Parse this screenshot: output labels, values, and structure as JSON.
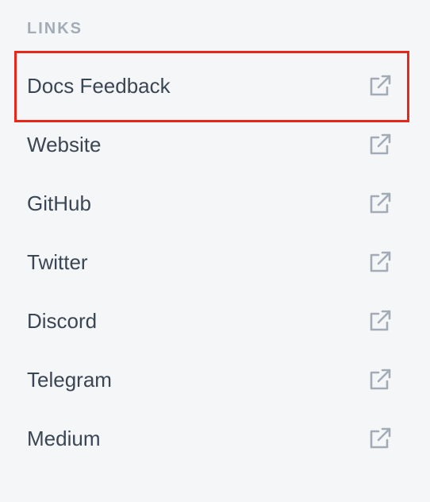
{
  "links_section": {
    "heading": "LINKS",
    "items": [
      {
        "label": "Docs Feedback",
        "icon": "external-link-icon",
        "highlighted": true
      },
      {
        "label": "Website",
        "icon": "external-link-icon",
        "highlighted": false
      },
      {
        "label": "GitHub",
        "icon": "external-link-icon",
        "highlighted": false
      },
      {
        "label": "Twitter",
        "icon": "external-link-icon",
        "highlighted": false
      },
      {
        "label": "Discord",
        "icon": "external-link-icon",
        "highlighted": false
      },
      {
        "label": "Telegram",
        "icon": "external-link-icon",
        "highlighted": false
      },
      {
        "label": "Medium",
        "icon": "external-link-icon",
        "highlighted": false
      }
    ]
  },
  "colors": {
    "background": "#f5f6f8",
    "heading": "#a3acb6",
    "label": "#3b4654",
    "icon": "#a3acb6",
    "highlight_border": "#e8261a"
  }
}
